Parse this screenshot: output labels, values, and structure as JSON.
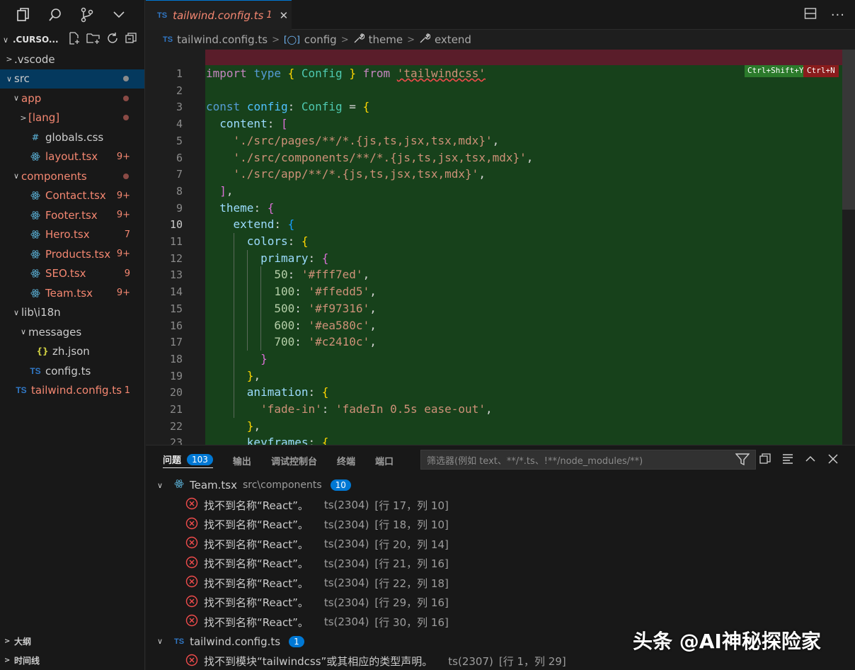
{
  "explorer": {
    "root_label": ".CURSO...",
    "items": [
      {
        "label": ".vscode",
        "indent": 0,
        "chevron": "right",
        "icon": "",
        "color": "#cccccc",
        "badge": "",
        "dot": ""
      },
      {
        "label": "src",
        "indent": 0,
        "chevron": "down",
        "icon": "",
        "color": "#cccccc",
        "badge": "",
        "dot": "#8b8b8b",
        "selected": true
      },
      {
        "label": "app",
        "indent": 1,
        "chevron": "down",
        "icon": "",
        "color": "#f48771",
        "badge": "",
        "dot": "#8a4a45"
      },
      {
        "label": "[lang]",
        "indent": 2,
        "chevron": "right",
        "icon": "",
        "color": "#f48771",
        "badge": "",
        "dot": "#8a4a45"
      },
      {
        "label": "globals.css",
        "indent": 2,
        "chevron": "",
        "icon": "#",
        "iconColor": "#519aba",
        "color": "#cccccc",
        "badge": "",
        "dot": ""
      },
      {
        "label": "layout.tsx",
        "indent": 2,
        "chevron": "",
        "icon": "react",
        "iconColor": "#519aba",
        "color": "#f48771",
        "badge": "9+",
        "dot": ""
      },
      {
        "label": "components",
        "indent": 1,
        "chevron": "down",
        "icon": "",
        "color": "#f48771",
        "badge": "",
        "dot": "#8a4a45"
      },
      {
        "label": "Contact.tsx",
        "indent": 2,
        "chevron": "",
        "icon": "react",
        "iconColor": "#519aba",
        "color": "#f48771",
        "badge": "9+",
        "dot": ""
      },
      {
        "label": "Footer.tsx",
        "indent": 2,
        "chevron": "",
        "icon": "react",
        "iconColor": "#519aba",
        "color": "#f48771",
        "badge": "9+",
        "dot": ""
      },
      {
        "label": "Hero.tsx",
        "indent": 2,
        "chevron": "",
        "icon": "react",
        "iconColor": "#519aba",
        "color": "#f48771",
        "badge": "7",
        "dot": ""
      },
      {
        "label": "Products.tsx",
        "indent": 2,
        "chevron": "",
        "icon": "react",
        "iconColor": "#519aba",
        "color": "#f48771",
        "badge": "9+",
        "dot": ""
      },
      {
        "label": "SEO.tsx",
        "indent": 2,
        "chevron": "",
        "icon": "react",
        "iconColor": "#519aba",
        "color": "#f48771",
        "badge": "9",
        "dot": ""
      },
      {
        "label": "Team.tsx",
        "indent": 2,
        "chevron": "",
        "icon": "react",
        "iconColor": "#519aba",
        "color": "#f48771",
        "badge": "9+",
        "dot": ""
      },
      {
        "label": "lib\\i18n",
        "indent": 1,
        "chevron": "down",
        "icon": "",
        "color": "#cccccc",
        "badge": "",
        "dot": ""
      },
      {
        "label": "messages",
        "indent": 2,
        "chevron": "down",
        "icon": "",
        "color": "#cccccc",
        "badge": "",
        "dot": ""
      },
      {
        "label": "zh.json",
        "indent": 3,
        "chevron": "",
        "icon": "{}",
        "iconColor": "#cbcb41",
        "color": "#cccccc",
        "badge": "",
        "dot": ""
      },
      {
        "label": "config.ts",
        "indent": 2,
        "chevron": "",
        "icon": "TS",
        "iconColor": "#3178c6",
        "color": "#cccccc",
        "badge": "",
        "dot": ""
      },
      {
        "label": "tailwind.config.ts",
        "indent": 0,
        "chevron": "",
        "icon": "TS",
        "iconColor": "#3178c6",
        "color": "#f48771",
        "badge": "1",
        "dot": ""
      }
    ],
    "outline_label": "大纲",
    "timeline_label": "时间线"
  },
  "tab": {
    "icon": "TS",
    "name": "tailwind.config.ts",
    "count": "1"
  },
  "breadcrumb": {
    "file": "tailwind.config.ts",
    "items": [
      "config",
      "theme",
      "extend"
    ]
  },
  "editor": {
    "current_line": 10,
    "keybind_accept": "Ctrl+Shift+Y",
    "keybind_reject": "Ctrl+N",
    "lines": [
      {
        "n": "1",
        "t": [
          [
            "kw",
            "import"
          ],
          [
            "",
            "&nbsp;"
          ],
          [
            "k",
            "type"
          ],
          [
            "",
            "&nbsp;"
          ],
          [
            "b1",
            "{"
          ],
          [
            "",
            "&nbsp;"
          ],
          [
            "ty",
            "Config"
          ],
          [
            "",
            "&nbsp;"
          ],
          [
            "b1",
            "}"
          ],
          [
            "",
            "&nbsp;"
          ],
          [
            "kw",
            "from"
          ],
          [
            "",
            "&nbsp;"
          ],
          [
            "s squig",
            "'tailwindcss'"
          ]
        ]
      },
      {
        "n": "2",
        "t": []
      },
      {
        "n": "3",
        "t": [
          [
            "k",
            "const"
          ],
          [
            "",
            "&nbsp;"
          ],
          [
            "v",
            "config"
          ],
          [
            "",
            ":&nbsp;"
          ],
          [
            "ty",
            "Config"
          ],
          [
            "",
            "&nbsp;=&nbsp;"
          ],
          [
            "b1",
            "{"
          ]
        ]
      },
      {
        "n": "4",
        "t": [
          [
            "",
            "&nbsp;&nbsp;"
          ],
          [
            "p",
            "content"
          ],
          [
            "",
            ":&nbsp;"
          ],
          [
            "b2",
            "["
          ]
        ]
      },
      {
        "n": "5",
        "t": [
          [
            "",
            "&nbsp;&nbsp;&nbsp;&nbsp;"
          ],
          [
            "s",
            "'./src/pages/**/*.{js,ts,jsx,tsx,mdx}'"
          ],
          [
            "",
            ","
          ]
        ]
      },
      {
        "n": "6",
        "t": [
          [
            "",
            "&nbsp;&nbsp;&nbsp;&nbsp;"
          ],
          [
            "s",
            "'./src/components/**/*.{js,ts,jsx,tsx,mdx}'"
          ],
          [
            "",
            ","
          ]
        ]
      },
      {
        "n": "7",
        "t": [
          [
            "",
            "&nbsp;&nbsp;&nbsp;&nbsp;"
          ],
          [
            "s",
            "'./src/app/**/*.{js,ts,jsx,tsx,mdx}'"
          ],
          [
            "",
            ","
          ]
        ]
      },
      {
        "n": "8",
        "t": [
          [
            "",
            "&nbsp;&nbsp;"
          ],
          [
            "b2",
            "]"
          ],
          [
            "",
            ","
          ]
        ]
      },
      {
        "n": "9",
        "t": [
          [
            "",
            "&nbsp;&nbsp;"
          ],
          [
            "p",
            "theme"
          ],
          [
            "",
            ":&nbsp;"
          ],
          [
            "b2",
            "{"
          ]
        ]
      },
      {
        "n": "10",
        "t": [
          [
            "",
            "&nbsp;&nbsp;&nbsp;&nbsp;"
          ],
          [
            "p",
            "extend"
          ],
          [
            "",
            ":&nbsp;"
          ],
          [
            "b3",
            "{"
          ]
        ]
      },
      {
        "n": "11",
        "t": [
          [
            "",
            "&nbsp;&nbsp;&nbsp;&nbsp;&nbsp;&nbsp;"
          ],
          [
            "p",
            "colors"
          ],
          [
            "",
            ":&nbsp;"
          ],
          [
            "b1",
            "{"
          ]
        ]
      },
      {
        "n": "12",
        "t": [
          [
            "",
            "&nbsp;&nbsp;&nbsp;&nbsp;&nbsp;&nbsp;&nbsp;&nbsp;"
          ],
          [
            "p",
            "primary"
          ],
          [
            "",
            ":&nbsp;"
          ],
          [
            "b2",
            "{"
          ]
        ]
      },
      {
        "n": "13",
        "t": [
          [
            "",
            "&nbsp;&nbsp;&nbsp;&nbsp;&nbsp;&nbsp;&nbsp;&nbsp;&nbsp;&nbsp;"
          ],
          [
            "n",
            "50"
          ],
          [
            "",
            ":&nbsp;"
          ],
          [
            "s",
            "'#fff7ed'"
          ],
          [
            "",
            ","
          ]
        ]
      },
      {
        "n": "14",
        "t": [
          [
            "",
            "&nbsp;&nbsp;&nbsp;&nbsp;&nbsp;&nbsp;&nbsp;&nbsp;&nbsp;&nbsp;"
          ],
          [
            "n",
            "100"
          ],
          [
            "",
            ":&nbsp;"
          ],
          [
            "s",
            "'#ffedd5'"
          ],
          [
            "",
            ","
          ]
        ]
      },
      {
        "n": "15",
        "t": [
          [
            "",
            "&nbsp;&nbsp;&nbsp;&nbsp;&nbsp;&nbsp;&nbsp;&nbsp;&nbsp;&nbsp;"
          ],
          [
            "n",
            "500"
          ],
          [
            "",
            ":&nbsp;"
          ],
          [
            "s",
            "'#f97316'"
          ],
          [
            "",
            ","
          ]
        ]
      },
      {
        "n": "16",
        "t": [
          [
            "",
            "&nbsp;&nbsp;&nbsp;&nbsp;&nbsp;&nbsp;&nbsp;&nbsp;&nbsp;&nbsp;"
          ],
          [
            "n",
            "600"
          ],
          [
            "",
            ":&nbsp;"
          ],
          [
            "s",
            "'#ea580c'"
          ],
          [
            "",
            ","
          ]
        ]
      },
      {
        "n": "17",
        "t": [
          [
            "",
            "&nbsp;&nbsp;&nbsp;&nbsp;&nbsp;&nbsp;&nbsp;&nbsp;&nbsp;&nbsp;"
          ],
          [
            "n",
            "700"
          ],
          [
            "",
            ":&nbsp;"
          ],
          [
            "s",
            "'#c2410c'"
          ],
          [
            "",
            ","
          ]
        ]
      },
      {
        "n": "18",
        "t": [
          [
            "",
            "&nbsp;&nbsp;&nbsp;&nbsp;&nbsp;&nbsp;&nbsp;&nbsp;"
          ],
          [
            "b2",
            "}"
          ]
        ]
      },
      {
        "n": "19",
        "t": [
          [
            "",
            "&nbsp;&nbsp;&nbsp;&nbsp;&nbsp;&nbsp;"
          ],
          [
            "b1",
            "}"
          ],
          [
            "",
            ","
          ]
        ]
      },
      {
        "n": "20",
        "t": [
          [
            "",
            "&nbsp;&nbsp;&nbsp;&nbsp;&nbsp;&nbsp;"
          ],
          [
            "p",
            "animation"
          ],
          [
            "",
            ":&nbsp;"
          ],
          [
            "b1",
            "{"
          ]
        ]
      },
      {
        "n": "21",
        "t": [
          [
            "",
            "&nbsp;&nbsp;&nbsp;&nbsp;&nbsp;&nbsp;&nbsp;&nbsp;"
          ],
          [
            "s",
            "'fade-in'"
          ],
          [
            "",
            ":&nbsp;"
          ],
          [
            "s",
            "'fadeIn 0.5s ease-out'"
          ],
          [
            "",
            ","
          ]
        ]
      },
      {
        "n": "22",
        "t": [
          [
            "",
            "&nbsp;&nbsp;&nbsp;&nbsp;&nbsp;&nbsp;"
          ],
          [
            "b1",
            "}"
          ],
          [
            "",
            ","
          ]
        ]
      },
      {
        "n": "23",
        "t": [
          [
            "",
            "&nbsp;&nbsp;&nbsp;&nbsp;&nbsp;&nbsp;"
          ],
          [
            "p",
            "keyframes"
          ],
          [
            "",
            ":&nbsp;"
          ],
          [
            "b1",
            "{"
          ]
        ]
      }
    ]
  },
  "panel": {
    "tabs": [
      "问题",
      "输出",
      "调试控制台",
      "终端",
      "端口"
    ],
    "problems_count": "103",
    "filter_placeholder": "筛选器(例如 text、**/*.ts、!**/node_modules/**)",
    "groups": [
      {
        "file": "Team.tsx",
        "path": "src\\components",
        "count": "10",
        "icon": "react",
        "issues": [
          {
            "msg": "找不到名称“React”。",
            "code": "ts(2304)",
            "loc": "[行 17，列 10]"
          },
          {
            "msg": "找不到名称“React”。",
            "code": "ts(2304)",
            "loc": "[行 18，列 10]"
          },
          {
            "msg": "找不到名称“React”。",
            "code": "ts(2304)",
            "loc": "[行 20，列 14]"
          },
          {
            "msg": "找不到名称“React”。",
            "code": "ts(2304)",
            "loc": "[行 21，列 16]"
          },
          {
            "msg": "找不到名称“React”。",
            "code": "ts(2304)",
            "loc": "[行 22，列 18]"
          },
          {
            "msg": "找不到名称“React”。",
            "code": "ts(2304)",
            "loc": "[行 29，列 16]"
          },
          {
            "msg": "找不到名称“React”。",
            "code": "ts(2304)",
            "loc": "[行 30，列 16]"
          }
        ]
      },
      {
        "file": "tailwind.config.ts",
        "path": "",
        "count": "1",
        "icon": "TS",
        "issues": [
          {
            "msg": "找不到模块“tailwindcss”或其相应的类型声明。",
            "code": "ts(2307)",
            "loc": "[行 1，列 29]"
          }
        ]
      }
    ]
  },
  "watermark": "头条 @AI神秘探险家",
  "colors": {
    "accent": "#0078d4",
    "error": "#f48771",
    "diff_added": "#17411b",
    "diff_removed": "#5a1d2a"
  }
}
